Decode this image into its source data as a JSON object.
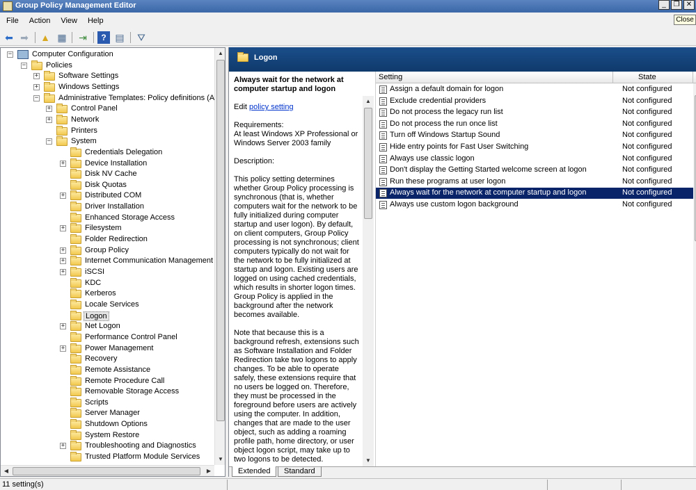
{
  "window": {
    "title": "Group Policy Management Editor",
    "tooltip_close": "Close"
  },
  "menu": [
    "File",
    "Action",
    "View",
    "Help"
  ],
  "toolbar": [
    "back-arrow-icon",
    "forward-arrow-icon",
    "up-folder-icon",
    "show-hide-tree-icon",
    "export-list-icon",
    "help-icon",
    "properties-icon",
    "filter-icon"
  ],
  "tree": [
    {
      "label": "Computer Configuration",
      "level": 0,
      "expander": "minus",
      "icon": "computer"
    },
    {
      "label": "Policies",
      "level": 1,
      "expander": "minus",
      "icon": "folder"
    },
    {
      "label": "Software Settings",
      "level": 2,
      "expander": "plus",
      "icon": "folder"
    },
    {
      "label": "Windows Settings",
      "level": 2,
      "expander": "plus",
      "icon": "folder"
    },
    {
      "label": "Administrative Templates: Policy definitions (ADM",
      "level": 2,
      "expander": "minus",
      "icon": "folder"
    },
    {
      "label": "Control Panel",
      "level": 3,
      "expander": "plus",
      "icon": "folder"
    },
    {
      "label": "Network",
      "level": 3,
      "expander": "plus",
      "icon": "folder"
    },
    {
      "label": "Printers",
      "level": 3,
      "expander": "",
      "icon": "folder"
    },
    {
      "label": "System",
      "level": 3,
      "expander": "minus",
      "icon": "folder"
    },
    {
      "label": "Credentials Delegation",
      "level": 4,
      "expander": "",
      "icon": "folder"
    },
    {
      "label": "Device Installation",
      "level": 4,
      "expander": "plus",
      "icon": "folder"
    },
    {
      "label": "Disk NV Cache",
      "level": 4,
      "expander": "",
      "icon": "folder"
    },
    {
      "label": "Disk Quotas",
      "level": 4,
      "expander": "",
      "icon": "folder"
    },
    {
      "label": "Distributed COM",
      "level": 4,
      "expander": "plus",
      "icon": "folder"
    },
    {
      "label": "Driver Installation",
      "level": 4,
      "expander": "",
      "icon": "folder"
    },
    {
      "label": "Enhanced Storage Access",
      "level": 4,
      "expander": "",
      "icon": "folder"
    },
    {
      "label": "Filesystem",
      "level": 4,
      "expander": "plus",
      "icon": "folder"
    },
    {
      "label": "Folder Redirection",
      "level": 4,
      "expander": "",
      "icon": "folder"
    },
    {
      "label": "Group Policy",
      "level": 4,
      "expander": "plus",
      "icon": "folder"
    },
    {
      "label": "Internet Communication Management",
      "level": 4,
      "expander": "plus",
      "icon": "folder"
    },
    {
      "label": "iSCSI",
      "level": 4,
      "expander": "plus",
      "icon": "folder"
    },
    {
      "label": "KDC",
      "level": 4,
      "expander": "",
      "icon": "folder"
    },
    {
      "label": "Kerberos",
      "level": 4,
      "expander": "",
      "icon": "folder"
    },
    {
      "label": "Locale Services",
      "level": 4,
      "expander": "",
      "icon": "folder"
    },
    {
      "label": "Logon",
      "level": 4,
      "expander": "",
      "icon": "folder",
      "selected": true
    },
    {
      "label": "Net Logon",
      "level": 4,
      "expander": "plus",
      "icon": "folder"
    },
    {
      "label": "Performance Control Panel",
      "level": 4,
      "expander": "",
      "icon": "folder"
    },
    {
      "label": "Power Management",
      "level": 4,
      "expander": "plus",
      "icon": "folder"
    },
    {
      "label": "Recovery",
      "level": 4,
      "expander": "",
      "icon": "folder"
    },
    {
      "label": "Remote Assistance",
      "level": 4,
      "expander": "",
      "icon": "folder"
    },
    {
      "label": "Remote Procedure Call",
      "level": 4,
      "expander": "",
      "icon": "folder"
    },
    {
      "label": "Removable Storage Access",
      "level": 4,
      "expander": "",
      "icon": "folder"
    },
    {
      "label": "Scripts",
      "level": 4,
      "expander": "",
      "icon": "folder"
    },
    {
      "label": "Server Manager",
      "level": 4,
      "expander": "",
      "icon": "folder"
    },
    {
      "label": "Shutdown Options",
      "level": 4,
      "expander": "",
      "icon": "folder"
    },
    {
      "label": "System Restore",
      "level": 4,
      "expander": "",
      "icon": "folder"
    },
    {
      "label": "Troubleshooting and Diagnostics",
      "level": 4,
      "expander": "plus",
      "icon": "folder"
    },
    {
      "label": "Trusted Platform Module Services",
      "level": 4,
      "expander": "",
      "icon": "folder"
    }
  ],
  "right": {
    "header_title": "Logon",
    "extended": {
      "title": "Always wait for the network at computer startup and logon",
      "edit_prefix": "Edit ",
      "edit_link": "policy setting",
      "requirements_label": "Requirements:",
      "requirements": "At least Windows XP Professional or Windows Server 2003 family",
      "description_label": "Description:",
      "description_1": "This policy setting determines whether Group Policy processing is synchronous (that is, whether computers wait for the network to be fully initialized during computer startup and user logon). By default, on client computers, Group Policy processing is not synchronous; client computers typically do not wait for the network to be fully initialized at startup and logon. Existing users are logged on using cached credentials, which results in shorter logon times. Group Policy is applied in the background after the network becomes available.",
      "description_2": "Note that because this is a background refresh, extensions such as Software Installation and Folder Redirection take two logons to apply changes. To be able to operate safely, these extensions require that no users be logged on. Therefore, they must be processed in the foreground before users are actively using the computer. In addition, changes that are made to the user object, such as adding a roaming profile path, home directory, or user object logon script, may take up to two logons to be detected."
    },
    "columns": {
      "setting": "Setting",
      "state": "State"
    },
    "rows": [
      {
        "setting": "Assign a default domain for logon",
        "state": "Not configured"
      },
      {
        "setting": "Exclude credential providers",
        "state": "Not configured"
      },
      {
        "setting": "Do not process the legacy run list",
        "state": "Not configured"
      },
      {
        "setting": "Do not process the run once list",
        "state": "Not configured"
      },
      {
        "setting": "Turn off Windows Startup Sound",
        "state": "Not configured"
      },
      {
        "setting": "Hide entry points for Fast User Switching",
        "state": "Not configured"
      },
      {
        "setting": "Always use classic logon",
        "state": "Not configured"
      },
      {
        "setting": "Don't display the Getting Started welcome screen at logon",
        "state": "Not configured"
      },
      {
        "setting": "Run these programs at user logon",
        "state": "Not configured"
      },
      {
        "setting": "Always wait for the network at computer startup and logon",
        "state": "Not configured",
        "selected": true
      },
      {
        "setting": "Always use custom logon background",
        "state": "Not configured"
      }
    ],
    "tabs": [
      {
        "label": "Extended",
        "active": true
      },
      {
        "label": "Standard",
        "active": false
      }
    ]
  },
  "status": {
    "text": "11 setting(s)"
  },
  "colors": {
    "title_bar": "#3b67a8",
    "pane_header": "#0f3a6c",
    "selection": "#0a246a",
    "link": "#0033cc"
  }
}
